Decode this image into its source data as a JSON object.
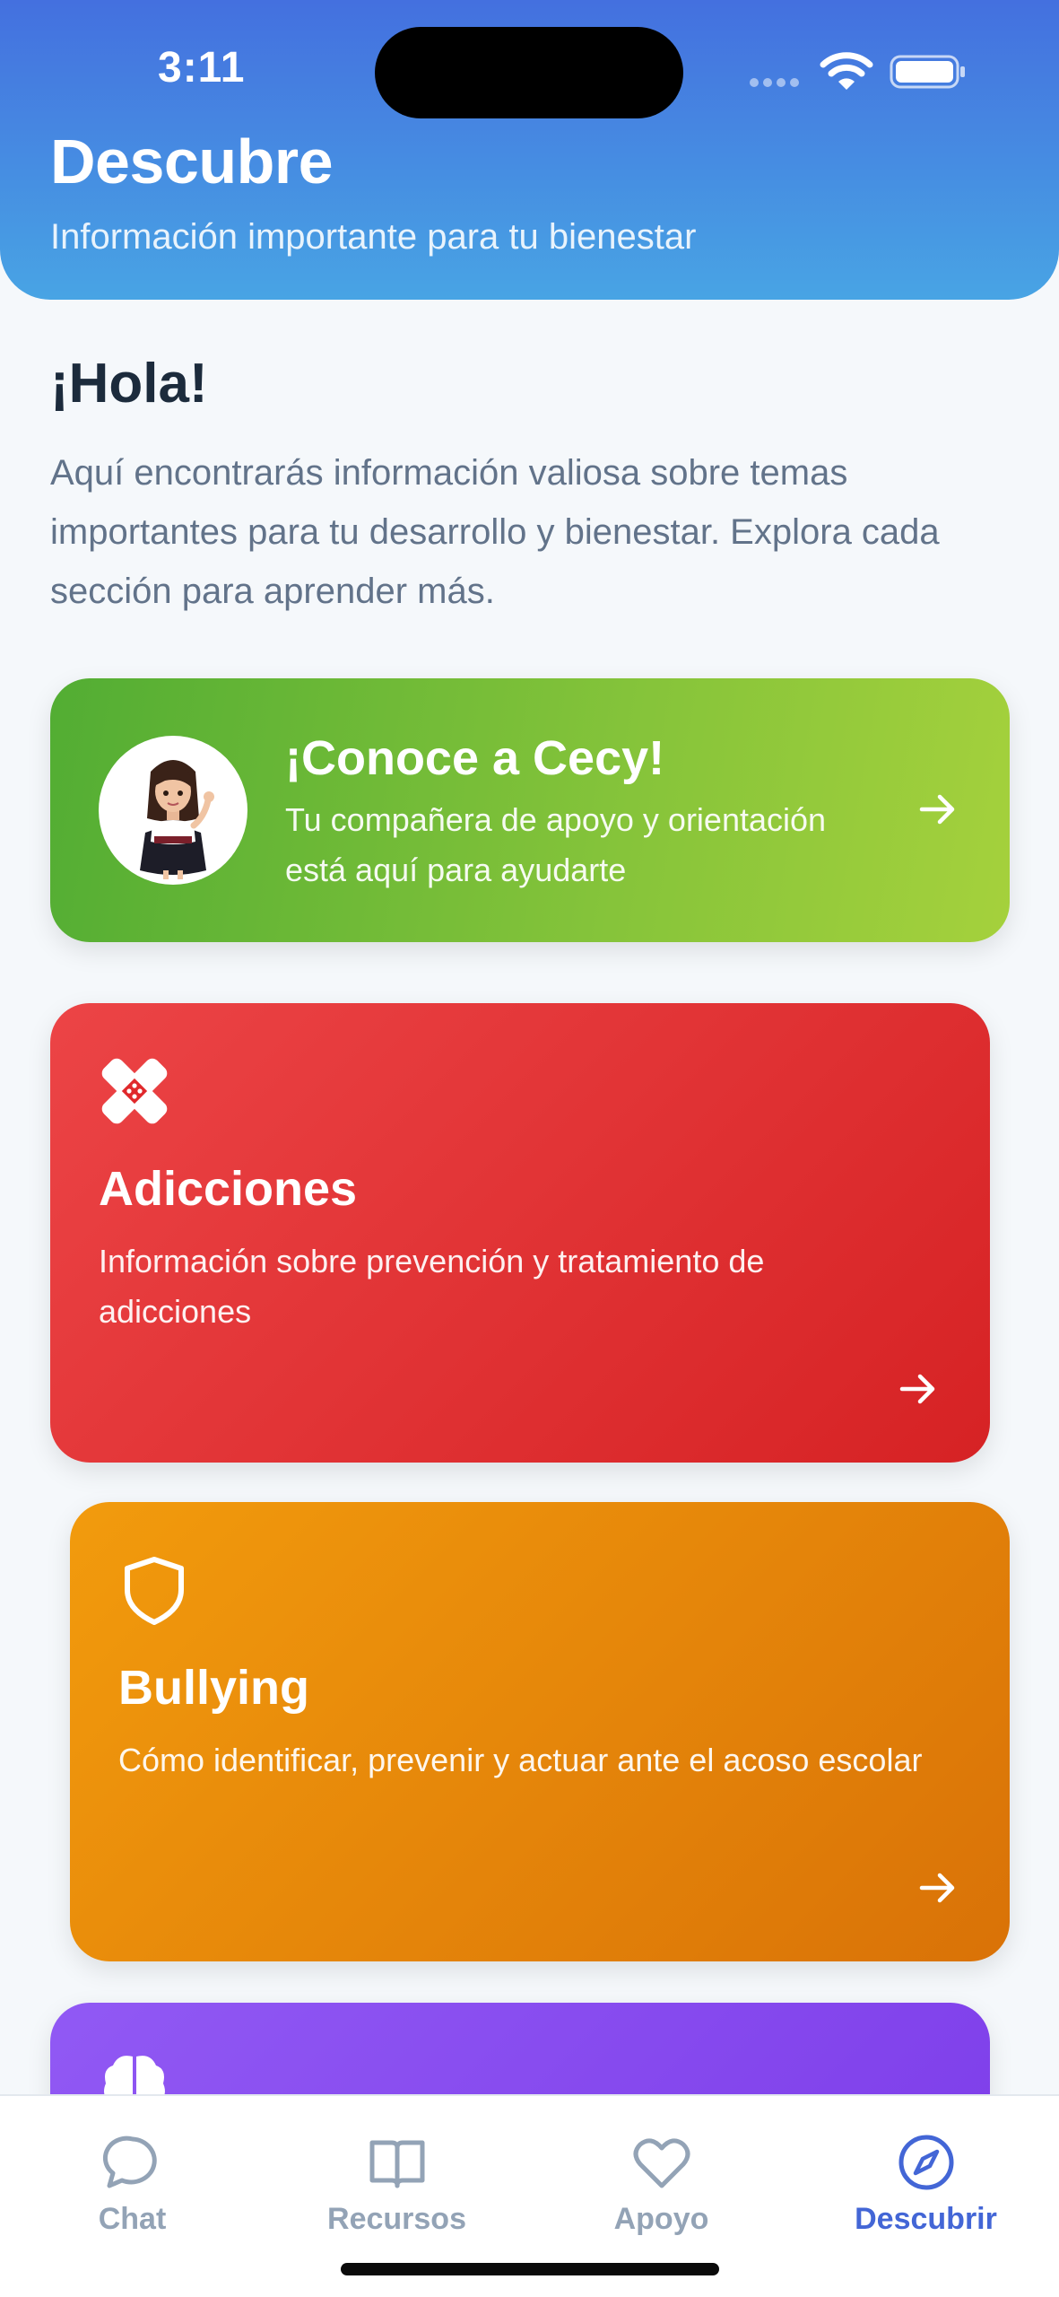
{
  "status_bar": {
    "time": "3:11"
  },
  "header": {
    "title": "Descubre",
    "subtitle": "Información importante para tu bienestar"
  },
  "intro": {
    "greeting": "¡Hola!",
    "text": "Aquí encontrarás información valiosa sobre temas importantes para tu desarrollo y bienestar. Explora cada sección para aprender más."
  },
  "cecy_card": {
    "title": "¡Conoce a Cecy!",
    "text": "Tu compañera de apoyo y orientación está aquí para ayudarte"
  },
  "topics": [
    {
      "title": "Adicciones",
      "description": "Información sobre prevención y tratamiento de adicciones",
      "icon": "bandage-icon",
      "color": "#e0282b"
    },
    {
      "title": "Bullying",
      "description": "Cómo identificar, prevenir y actuar ante el acoso escolar",
      "icon": "shield-icon",
      "color": "#e5830b"
    },
    {
      "icon": "brain-icon",
      "color": "#8449ee"
    }
  ],
  "tabbar": {
    "tabs": [
      {
        "label": "Chat",
        "icon": "chat-bubble-icon",
        "active": false
      },
      {
        "label": "Recursos",
        "icon": "book-icon",
        "active": false
      },
      {
        "label": "Apoyo",
        "icon": "heart-icon",
        "active": false
      },
      {
        "label": "Descubrir",
        "icon": "compass-icon",
        "active": true
      }
    ],
    "active_color": "#4366d6",
    "inactive_color": "#93a3b6"
  },
  "colors": {
    "header_top": "#4470df",
    "header_bottom": "#48a4e4",
    "cecy_green": "#7bbd38"
  }
}
